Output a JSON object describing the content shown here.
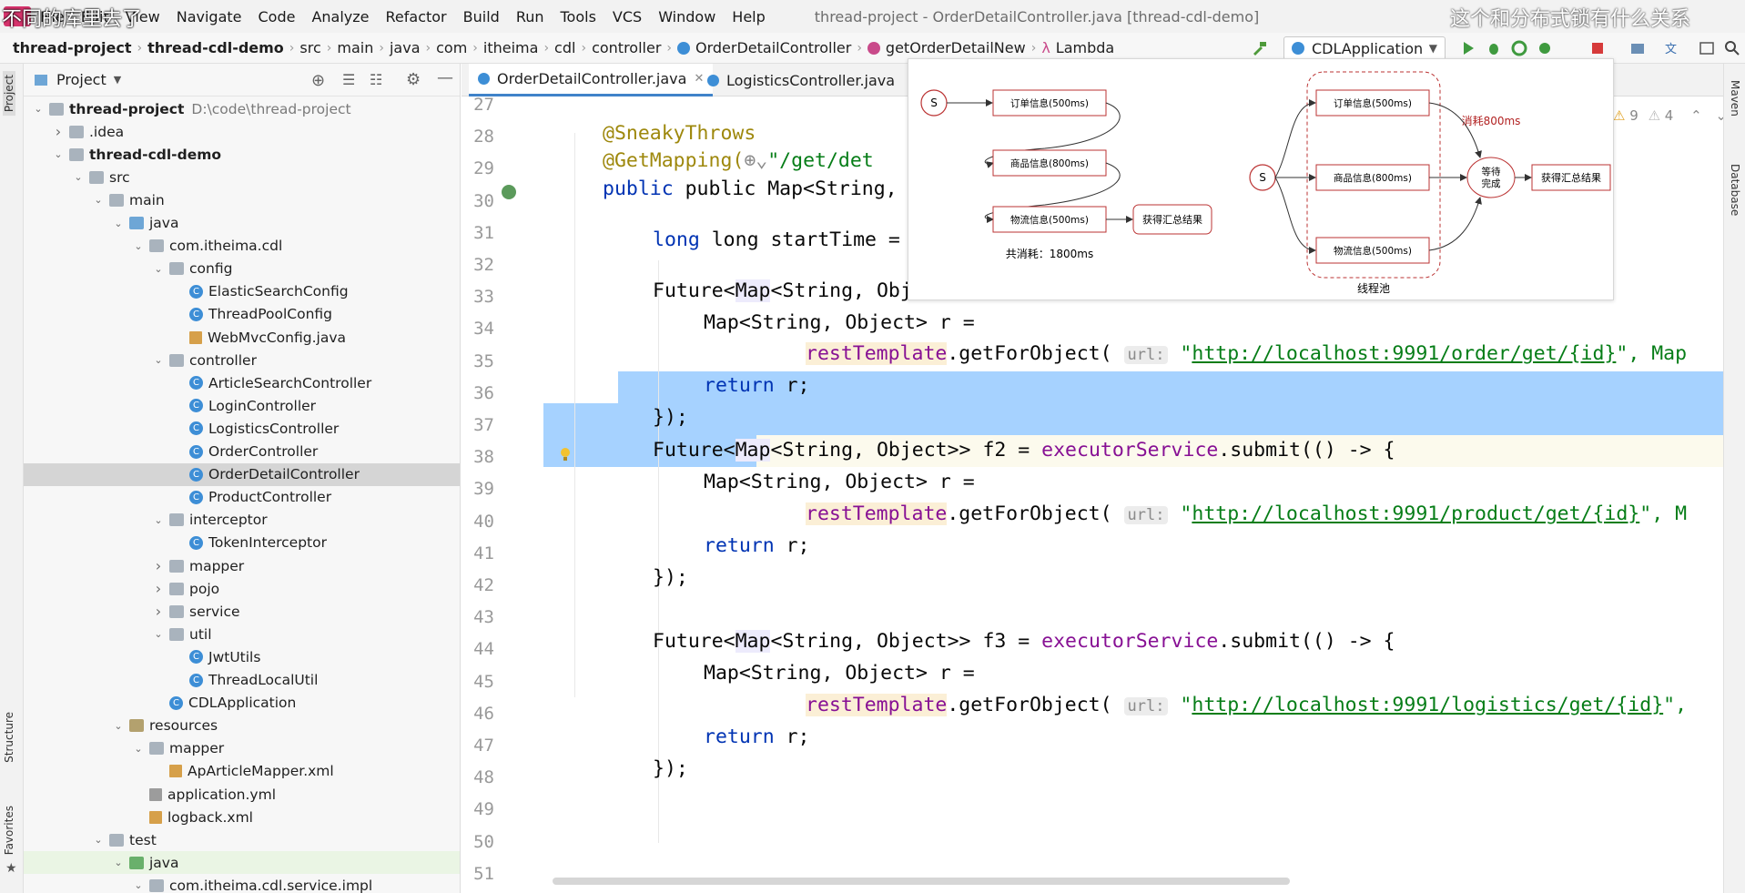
{
  "menubar": {
    "items": [
      "File",
      "Edit",
      "View",
      "Navigate",
      "Code",
      "Analyze",
      "Refactor",
      "Build",
      "Run",
      "Tools",
      "VCS",
      "Window",
      "Help"
    ],
    "title": "thread-project - OrderDetailController.java [thread-cdl-demo]"
  },
  "subtitles": {
    "left": "不同的库里去了",
    "right": "这个和分布式锁有什么关系"
  },
  "breadcrumb": [
    "thread-project",
    "thread-cdl-demo",
    "src",
    "main",
    "java",
    "com",
    "itheima",
    "cdl",
    "controller",
    "OrderDetailController",
    "getOrderDetailNew",
    "Lambda"
  ],
  "run_config": "CDLApplication",
  "project_panel": {
    "title": "Project",
    "rows": [
      {
        "label": "thread-project",
        "extra": "D:\\code\\thread-project",
        "depth": 0,
        "arrow": "down",
        "icon": "folder",
        "bold": true
      },
      {
        "label": ".idea",
        "depth": 1,
        "arrow": "right",
        "icon": "folder"
      },
      {
        "label": "thread-cdl-demo",
        "depth": 1,
        "arrow": "down",
        "icon": "folder",
        "bold": true
      },
      {
        "label": "src",
        "depth": 2,
        "arrow": "down",
        "icon": "folder"
      },
      {
        "label": "main",
        "depth": 3,
        "arrow": "down",
        "icon": "folder"
      },
      {
        "label": "java",
        "depth": 4,
        "arrow": "down",
        "icon": "folder-blue"
      },
      {
        "label": "com.itheima.cdl",
        "depth": 5,
        "arrow": "down",
        "icon": "folder-pkg"
      },
      {
        "label": "config",
        "depth": 6,
        "arrow": "down",
        "icon": "folder-pkg"
      },
      {
        "label": "ElasticSearchConfig",
        "depth": 7,
        "icon": "class"
      },
      {
        "label": "ThreadPoolConfig",
        "depth": 7,
        "icon": "class"
      },
      {
        "label": "WebMvcConfig.java",
        "depth": 7,
        "icon": "java"
      },
      {
        "label": "controller",
        "depth": 6,
        "arrow": "down",
        "icon": "folder-pkg"
      },
      {
        "label": "ArticleSearchController",
        "depth": 7,
        "icon": "class"
      },
      {
        "label": "LoginController",
        "depth": 7,
        "icon": "class"
      },
      {
        "label": "LogisticsController",
        "depth": 7,
        "icon": "class"
      },
      {
        "label": "OrderController",
        "depth": 7,
        "icon": "class"
      },
      {
        "label": "OrderDetailController",
        "depth": 7,
        "icon": "class",
        "selected": true
      },
      {
        "label": "ProductController",
        "depth": 7,
        "icon": "class"
      },
      {
        "label": "interceptor",
        "depth": 6,
        "arrow": "down",
        "icon": "folder-pkg"
      },
      {
        "label": "TokenInterceptor",
        "depth": 7,
        "icon": "class"
      },
      {
        "label": "mapper",
        "depth": 6,
        "arrow": "right",
        "icon": "folder-pkg"
      },
      {
        "label": "pojo",
        "depth": 6,
        "arrow": "right",
        "icon": "folder-pkg"
      },
      {
        "label": "service",
        "depth": 6,
        "arrow": "right",
        "icon": "folder-pkg"
      },
      {
        "label": "util",
        "depth": 6,
        "arrow": "down",
        "icon": "folder-pkg"
      },
      {
        "label": "JwtUtils",
        "depth": 7,
        "icon": "class"
      },
      {
        "label": "ThreadLocalUtil",
        "depth": 7,
        "icon": "class"
      },
      {
        "label": "CDLApplication",
        "depth": 6,
        "icon": "class"
      },
      {
        "label": "resources",
        "depth": 4,
        "arrow": "down",
        "icon": "folder-res"
      },
      {
        "label": "mapper",
        "depth": 5,
        "arrow": "down",
        "icon": "folder"
      },
      {
        "label": "ApArticleMapper.xml",
        "depth": 6,
        "icon": "xml"
      },
      {
        "label": "application.yml",
        "depth": 5,
        "icon": "yml"
      },
      {
        "label": "logback.xml",
        "depth": 5,
        "icon": "xml"
      },
      {
        "label": "test",
        "depth": 3,
        "arrow": "down",
        "icon": "folder"
      },
      {
        "label": "java",
        "depth": 4,
        "arrow": "down",
        "icon": "folder-green",
        "green": true
      },
      {
        "label": "com.itheima.cdl.service.impl",
        "depth": 5,
        "arrow": "down",
        "icon": "folder-pkg"
      }
    ]
  },
  "left_strip": {
    "project": "Project",
    "structure": "Structure",
    "favorites": "Favorites"
  },
  "right_strip": {
    "maven": "Maven",
    "database": "Database"
  },
  "tabs": [
    {
      "label": "OrderDetailController.java",
      "active": true
    },
    {
      "label": "LogisticsController.java",
      "active": false
    }
  ],
  "inspections": {
    "warnings": "9",
    "weak": "4"
  },
  "line_numbers": [
    "27",
    "28",
    "29",
    "30",
    "31",
    "32",
    "33",
    "34",
    "35",
    "36",
    "37",
    "38",
    "39",
    "40",
    "41",
    "42",
    "43",
    "44",
    "45",
    "46",
    "47",
    "48",
    "49",
    "50",
    "51"
  ],
  "code": {
    "l29": "@SneakyThrows",
    "l30a": "@GetMapping(",
    "l30b": "\"/get/det",
    "l31": "public Map<String, Objec",
    "l33a": "long startTime = Sys",
    "l35_kw": "Future<",
    "l35_gen": "Map",
    "l35_rest": "<String, Object>> f1 = ",
    "l35_exec": "executorService",
    "l35_tail": ".submit(() -> {",
    "l36": "Map<String, Object> r =",
    "l37_rt": "restTemplate",
    "l37_call": ".getForObject(",
    "hint_url": "url:",
    "l37_url": "http://localhost:9991/order/get/{id}",
    "l37_tail": "\", Map",
    "l38": "return r;",
    "l39": "});",
    "l40_rest": "<String, Object>> f2 = ",
    "l42_url": "http://localhost:9991/product/get/{id}",
    "l42_tail": "\", M",
    "l43": "return r;",
    "l44": "});",
    "l46_rest": "<String, Object>> f3 = ",
    "l48_url": "http://localhost:9991/logistics/get/{id}",
    "l48_tail": "\",",
    "l49": "return r;",
    "l50": "});"
  },
  "diagram": {
    "left": {
      "start": "S",
      "boxes": [
        "订单信息(500ms)",
        "商品信息(800ms)",
        "物流信息(500ms)"
      ],
      "result": "获得汇总结果",
      "caption": "共消耗：1800ms"
    },
    "right": {
      "start": "S",
      "boxes": [
        "订单信息(500ms)",
        "商品信息(800ms)",
        "物流信息(500ms)"
      ],
      "wait": [
        "等待",
        "完成"
      ],
      "result": "获得汇总结果",
      "cost": "消耗800ms",
      "caption": "线程池"
    }
  }
}
